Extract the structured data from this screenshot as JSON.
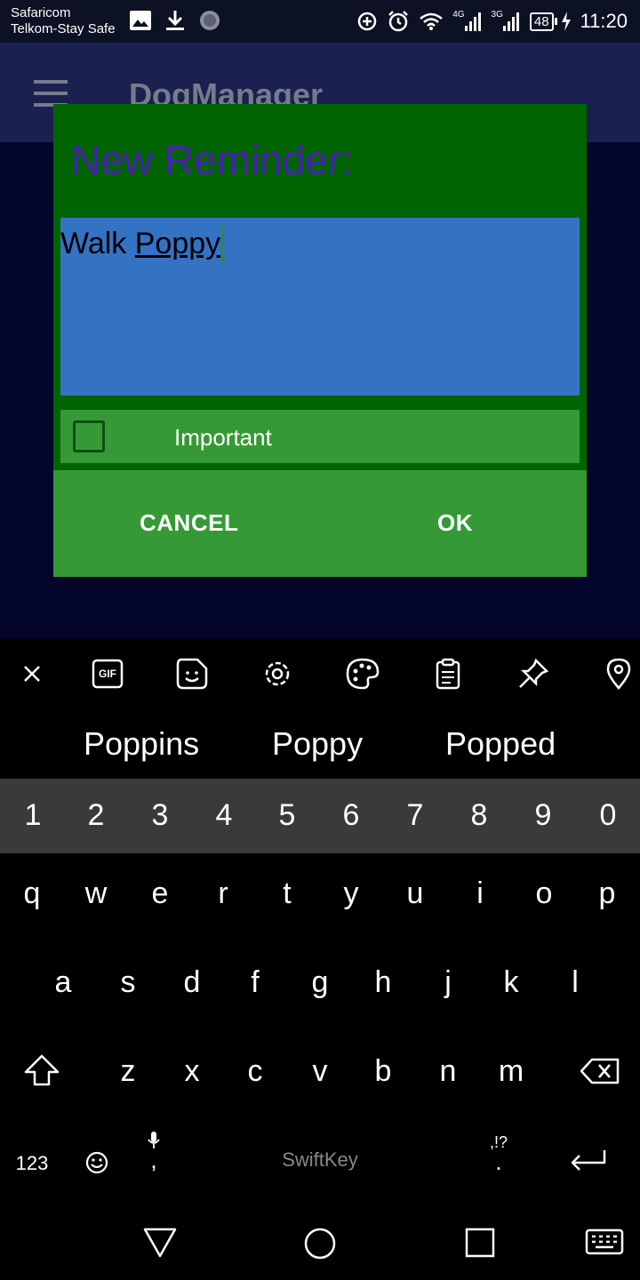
{
  "status_bar": {
    "carrier_1": "Safaricom",
    "carrier_2": "Telkom-Stay Safe",
    "net_1": "4G",
    "net_2": "3G",
    "battery": "48",
    "time": "11:20"
  },
  "app_bar": {
    "title": "DogManager"
  },
  "dialog": {
    "title": "New Reminder:",
    "input_word_1": "Walk",
    "input_word_2": "Poppy",
    "important_label": "Important",
    "important_checked": false,
    "cancel_label": "CANCEL",
    "ok_label": "OK"
  },
  "keyboard": {
    "toolbar_icons": [
      "close-icon",
      "gif-icon",
      "sticker-icon",
      "settings-icon",
      "theme-palette-icon",
      "clipboard-icon",
      "pin-icon",
      "location-icon"
    ],
    "gif_label": "GIF",
    "suggestions": [
      "Poppins",
      "Poppy",
      "Popped"
    ],
    "number_row": [
      "1",
      "2",
      "3",
      "4",
      "5",
      "6",
      "7",
      "8",
      "9",
      "0"
    ],
    "row_1": [
      "q",
      "w",
      "e",
      "r",
      "t",
      "y",
      "u",
      "i",
      "o",
      "p"
    ],
    "row_2": [
      "a",
      "s",
      "d",
      "f",
      "g",
      "h",
      "j",
      "k",
      "l"
    ],
    "row_3": [
      "z",
      "x",
      "c",
      "v",
      "b",
      "n",
      "m"
    ],
    "symbols_label": "123",
    "comma": ",",
    "period": ".",
    "punct_hint": ",!?",
    "brand": "SwiftKey"
  },
  "colors": {
    "dialog_bg": "#006400",
    "title_purple": "#4a1fb8",
    "input_blue": "#3472c4",
    "button_green": "#359a35"
  }
}
